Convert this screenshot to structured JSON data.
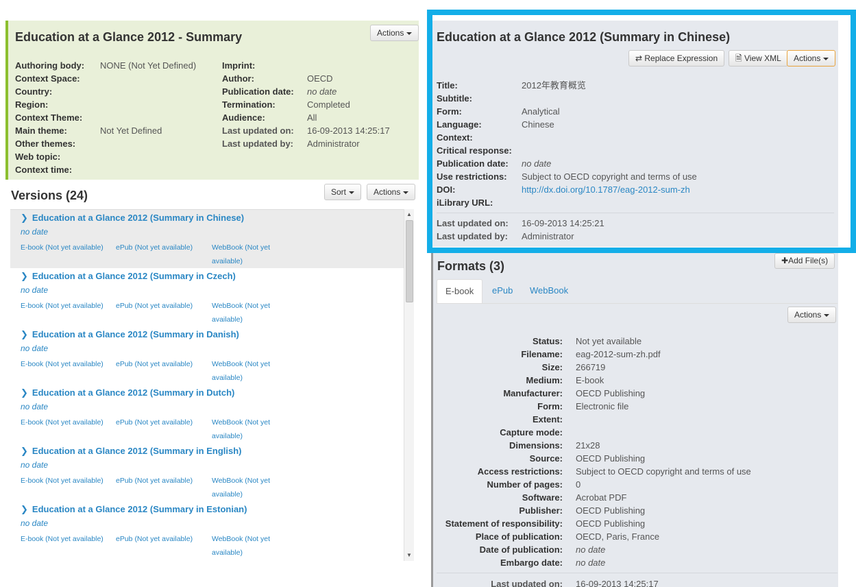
{
  "summary": {
    "title": "Education at a Glance 2012 - Summary",
    "actions_label": "Actions",
    "left_fields": [
      {
        "label": "Authoring body:",
        "value": "NONE (Not Yet Defined)"
      },
      {
        "label": "Context Space:",
        "value": ""
      },
      {
        "label": "Country:",
        "value": ""
      },
      {
        "label": "Region:",
        "value": ""
      },
      {
        "label": "Context Theme:",
        "value": ""
      },
      {
        "label": "Main theme:",
        "value": "Not Yet Defined"
      },
      {
        "label": "Other themes:",
        "value": ""
      },
      {
        "label": "Web topic:",
        "value": ""
      },
      {
        "label": "Context time:",
        "value": ""
      }
    ],
    "right_fields": [
      {
        "label": "Imprint:",
        "value": ""
      },
      {
        "label": "Author:",
        "value": "OECD"
      },
      {
        "label": "Publication date:",
        "value": "no date"
      },
      {
        "label": "Termination:",
        "value": "Completed"
      },
      {
        "label": "Audience:",
        "value": "All"
      },
      {
        "label": "Last updated on:",
        "value": "16-09-2013 14:25:17"
      },
      {
        "label": "Last updated by:",
        "value": "Administrator"
      }
    ]
  },
  "versions": {
    "title": "Versions (24)",
    "sort_label": "Sort",
    "actions_label": "Actions",
    "items": [
      {
        "title": "Education at a Glance 2012 (Summary in Chinese)",
        "date": "no date",
        "ebook": "E-book (Not yet available)",
        "epub": "ePub (Not yet available)",
        "webbook1": "WebBook (Not yet",
        "webbook2": "available)"
      },
      {
        "title": "Education at a Glance 2012 (Summary in Czech)",
        "date": "no date",
        "ebook": "E-book (Not yet available)",
        "epub": "ePub (Not yet available)",
        "webbook1": "WebBook (Not yet",
        "webbook2": "available)"
      },
      {
        "title": "Education at a Glance 2012 (Summary in Danish)",
        "date": "no date",
        "ebook": "E-book (Not yet available)",
        "epub": "ePub (Not yet available)",
        "webbook1": "WebBook (Not yet",
        "webbook2": "available)"
      },
      {
        "title": "Education at a Glance 2012 (Summary in Dutch)",
        "date": "no date",
        "ebook": "E-book (Not yet available)",
        "epub": "ePub (Not yet available)",
        "webbook1": "WebBook (Not yet",
        "webbook2": "available)"
      },
      {
        "title": "Education at a Glance 2012 (Summary in English)",
        "date": "no date",
        "ebook": "E-book (Not yet available)",
        "epub": "ePub (Not yet available)",
        "webbook1": "WebBook (Not yet",
        "webbook2": "available)"
      },
      {
        "title": "Education at a Glance 2012 (Summary in Estonian)",
        "date": "no date",
        "ebook": "E-book (Not yet available)",
        "epub": "ePub (Not yet available)",
        "webbook1": "WebBook (Not yet",
        "webbook2": "available)"
      }
    ]
  },
  "expression": {
    "title": "Education at a Glance 2012 (Summary in Chinese)",
    "replace_label": "Replace Expression",
    "view_xml_label": "View XML",
    "actions_label": "Actions",
    "fields": [
      {
        "label": "Title:",
        "value": "2012年教育概览"
      },
      {
        "label": "Subtitle:",
        "value": ""
      },
      {
        "label": "Form:",
        "value": "Analytical"
      },
      {
        "label": "Language:",
        "value": "Chinese"
      },
      {
        "label": "Context:",
        "value": ""
      },
      {
        "label": "Critical response:",
        "value": ""
      },
      {
        "label": "Publication date:",
        "value": "no date"
      },
      {
        "label": "Use restrictions:",
        "value": "Subject to OECD copyright and terms of use"
      },
      {
        "label": "DOI:",
        "value": "http://dx.doi.org/10.1787/eag-2012-sum-zh"
      },
      {
        "label": "iLibrary URL:",
        "value": ""
      }
    ],
    "updated_on_label": "Last updated on:",
    "updated_on": "16-09-2013 14:25:21",
    "updated_by_label": "Last updated by:",
    "updated_by": "Administrator"
  },
  "formats": {
    "title": "Formats (3)",
    "add_files_label": "Add File(s)",
    "tabs": [
      "E-book",
      "ePub",
      "WebBook"
    ],
    "actions_label": "Actions",
    "fields": [
      {
        "label": "Status:",
        "value": "Not yet available"
      },
      {
        "label": "Filename:",
        "value": "eag-2012-sum-zh.pdf"
      },
      {
        "label": "Size:",
        "value": "266719"
      },
      {
        "label": "Medium:",
        "value": "E-book"
      },
      {
        "label": "Manufacturer:",
        "value": "OECD Publishing"
      },
      {
        "label": "Form:",
        "value": "Electronic file"
      },
      {
        "label": "Extent:",
        "value": ""
      },
      {
        "label": "Capture mode:",
        "value": ""
      },
      {
        "label": "Dimensions:",
        "value": "21x28"
      },
      {
        "label": "Source:",
        "value": "OECD Publishing"
      },
      {
        "label": "Access restrictions:",
        "value": "Subject to OECD copyright and terms of use"
      },
      {
        "label": "Number of pages:",
        "value": "0"
      },
      {
        "label": "Software:",
        "value": "Acrobat PDF"
      },
      {
        "label": "Publisher:",
        "value": "OECD Publishing"
      },
      {
        "label": "Statement of responsibility:",
        "value": "OECD Publishing"
      },
      {
        "label": "Place of publication:",
        "value": "OECD, Paris, France"
      },
      {
        "label": "Date of publication:",
        "value": "no date"
      },
      {
        "label": "Embargo date:",
        "value": "no date"
      }
    ],
    "updated_on_label": "Last updated on:",
    "updated_on": "16-09-2013 14:25:17"
  },
  "colors": {
    "link": "#2a87c4",
    "highlight": "#13aee8",
    "summary_bg": "#e9f0d9",
    "panel_bg": "#e6e9ee"
  }
}
